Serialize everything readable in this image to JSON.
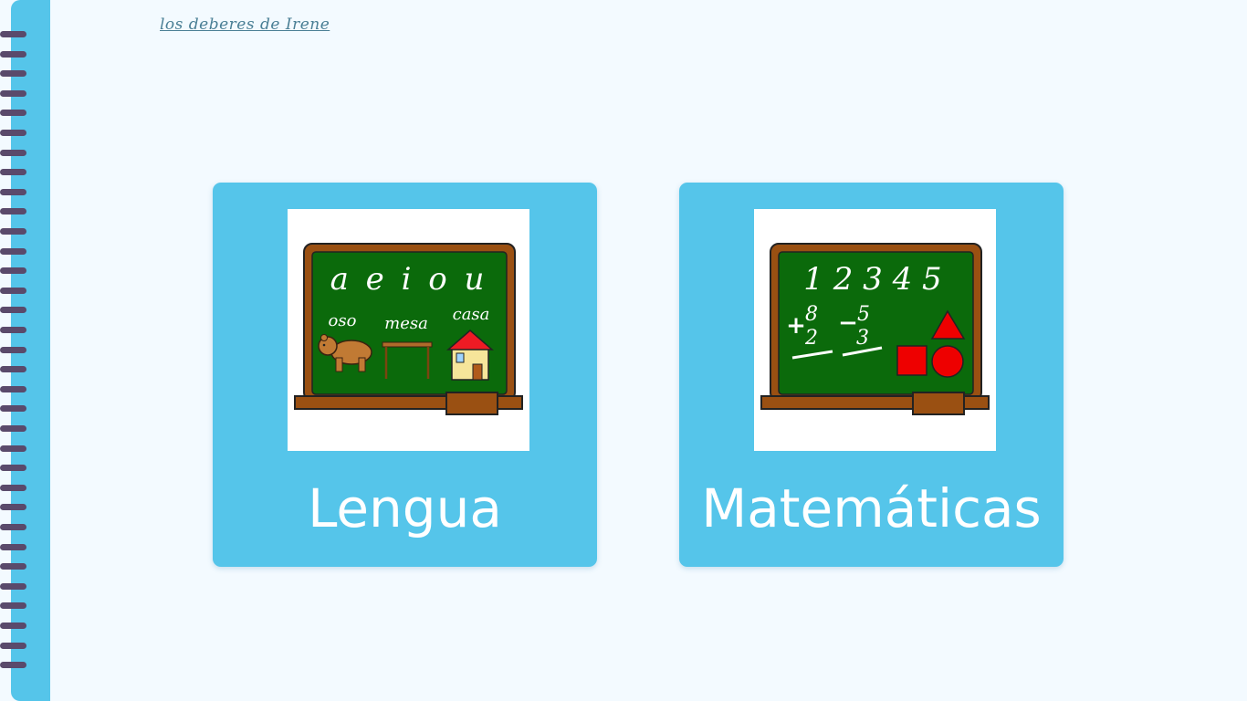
{
  "header": {
    "title": "los deberes de Irene"
  },
  "spine": {
    "ring_count": 33,
    "color": "#55c5ea",
    "ring_color": "#5a4a6b"
  },
  "subjects": [
    {
      "label": "Lengua",
      "board": {
        "vowels": "a e i o u",
        "words": [
          "oso",
          "mesa",
          "casa"
        ]
      }
    },
    {
      "label": "Matemáticas",
      "board": {
        "numbers": "1 2 3 4 5",
        "sum": [
          "+",
          "8",
          "2"
        ],
        "difference": [
          "−",
          "5",
          "3"
        ]
      }
    }
  ],
  "colors": {
    "background": "#f3faff",
    "card": "#55c5ea",
    "chalkboard": "#0b6a0b",
    "frame": "#9a5012",
    "shape": "#ee0000"
  }
}
